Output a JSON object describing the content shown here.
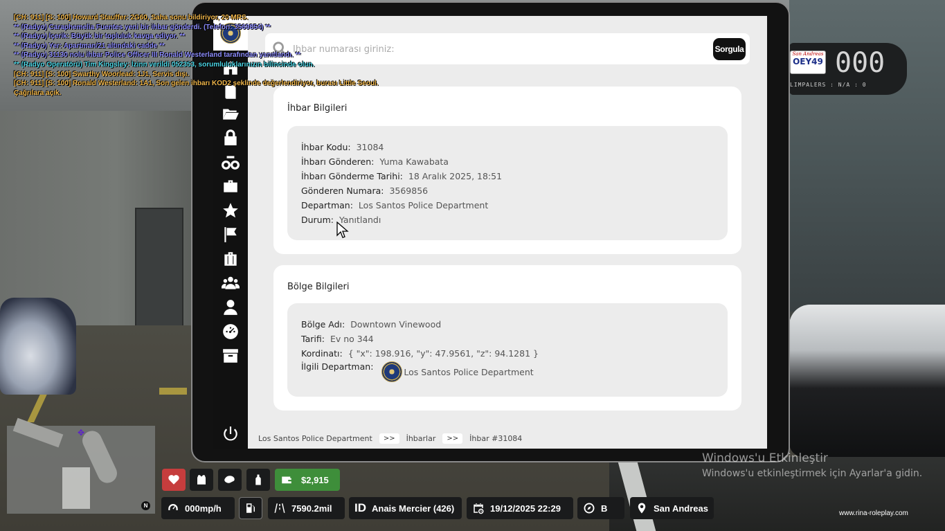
{
  "chat": [
    {
      "cls": "c-ch",
      "text": "[CH: 911] [S: 100] Howard Stauffer: 2G60, Saha sonu bildiriyor, 20 MRS."
    },
    {
      "cls": "c-radio",
      "text": "** (Radyo) Caraphemelia Fuentes yeni bir ihbar gönderdi. (Telefon: 3569854) **"
    },
    {
      "cls": "c-radio",
      "text": "** (Radyo) İçerik: Büyük bir topluluk kavga ediyor. **"
    },
    {
      "cls": "c-radio",
      "text": "** (Radyo) Yer: Apartman/21 altındaki cadde **"
    },
    {
      "cls": "c-radio",
      "text": "** (Radyo) 31130 nolu ihbar Police Officer III Ronald Westerland tarafından yanıtlandı. **"
    },
    {
      "cls": "c-op",
      "text": "** (Radyo Operatörü) Tim Kingsley: İzinn verildi 052353, sorumluluklarınızın bilincinde olun."
    },
    {
      "cls": "c-ch",
      "text": "[CH: 911] [S: 100] Swarthy Woorlead: 1J1, Servis dışı."
    },
    {
      "cls": "c-ch",
      "text": "[CH: 911] [S: 100] Ronald Westerland: 1A1, Son gelen ihbarı KOD2 şeklinde değerlendiriyor, burası Little Seoul."
    },
    {
      "cls": "c-ch",
      "text": "Çağrılara açık."
    }
  ],
  "search": {
    "placeholder": "İhbar numarası giriniz:",
    "button": "Sorgula"
  },
  "report": {
    "title": "İhbar Bilgileri",
    "fields": [
      {
        "key": "İhbar Kodu:",
        "value": "31084"
      },
      {
        "key": "İhbarı Gönderen:",
        "value": "Yuma Kawabata"
      },
      {
        "key": "İhbarı Gönderme Tarihi:",
        "value": "18 Aralık 2025, 18:51"
      },
      {
        "key": "Gönderen Numara:",
        "value": "3569856"
      },
      {
        "key": "Departman:",
        "value": "Los Santos Police Department"
      },
      {
        "key": "Durum:",
        "value": "Yanıtlandı"
      }
    ]
  },
  "region": {
    "title": "Bölge Bilgileri",
    "fields": [
      {
        "key": "Bölge Adı:",
        "value": "Downtown Vinewood"
      },
      {
        "key": "Tarifi:",
        "value": "Ev no 344"
      },
      {
        "key": "Kordinatı:",
        "value": "{ \"x\": 198.916, \"y\": 47.9561, \"z\": 94.1281 }"
      }
    ],
    "dept_key": "İlgili Departman:",
    "dept_value": "Los Santos Police Department"
  },
  "breadcrumb": {
    "items": [
      "Los Santos Police Department",
      "İhbarlar",
      "İhbar #31084"
    ],
    "sep": ">>"
  },
  "watermark": {
    "line1": "Windows'u Etkinleştir",
    "line2": "Windows'u etkinleştirmek için Ayarlar'a gidin."
  },
  "site": "www.rina-roleplay.com",
  "vehicle": {
    "plate_state": "San Andreas",
    "plate": "OEY49",
    "speed": "000",
    "limp": "LIMPALERS : N/A : 0"
  },
  "hud": {
    "money": "$2,915",
    "speed": "000mp/h",
    "odometer": "7590.2mil",
    "id_tag": "ID",
    "player": "Anais Mercier (426)",
    "datetime": "19/12/2025 22:29",
    "direction": "B",
    "location": "San Andreas",
    "north": "N"
  },
  "sidebar_icons": [
    "home-icon",
    "book-icon",
    "folder-icon",
    "lock-icon",
    "handcuffs-icon",
    "briefcase-icon",
    "star-icon",
    "flag-icon",
    "luggage-icon",
    "group-icon",
    "user-icon",
    "dashboard-icon",
    "archive-icon"
  ],
  "colors": {
    "accent": "#111111",
    "money_green": "#3e8e3a",
    "health_red": "#c63d3d"
  }
}
